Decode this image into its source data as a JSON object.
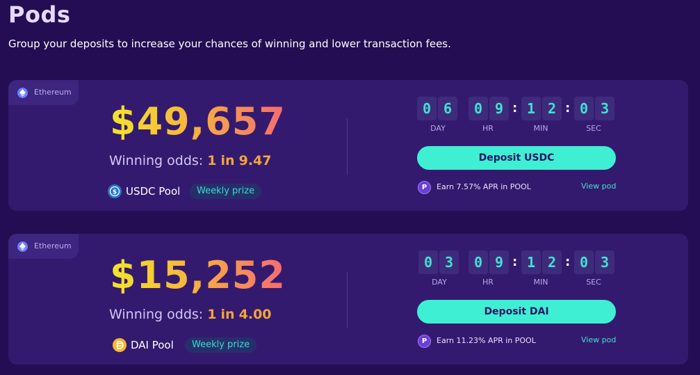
{
  "page": {
    "title": "Pods",
    "subtitle": "Group your deposits to increase your chances of winning and lower transaction fees."
  },
  "colors": {
    "background": "#240d52",
    "card": "#341a6e",
    "accent_teal": "#3fefd4",
    "odds_highlight": "#f1a53c",
    "prize_gradient": [
      "#f2e62b",
      "#f7b53c",
      "#f56a74"
    ]
  },
  "timer_labels": {
    "day": "DAY",
    "hr": "HR",
    "min": "MIN",
    "sec": "SEC"
  },
  "pods": [
    {
      "network": "Ethereum",
      "network_icon": "ethereum-icon",
      "prize": "$49,657",
      "odds_prefix": "Winning odds: ",
      "odds_one": "1",
      "odds_in": "in",
      "odds_value": "9.47",
      "token_icon": "usdc-icon",
      "pool_name": "USDC Pool",
      "prize_badge": "Weekly prize",
      "countdown": {
        "d1": "0",
        "d2": "6",
        "h1": "0",
        "h2": "9",
        "m1": "1",
        "m2": "2",
        "s1": "0",
        "s2": "3"
      },
      "deposit_label": "Deposit USDC",
      "apr_text": "Earn 7.57% APR in POOL",
      "view_label": "View pod"
    },
    {
      "network": "Ethereum",
      "network_icon": "ethereum-icon",
      "prize": "$15,252",
      "odds_prefix": "Winning odds: ",
      "odds_one": "1",
      "odds_in": "in",
      "odds_value": "4.00",
      "token_icon": "dai-icon",
      "pool_name": "DAI Pool",
      "prize_badge": "Weekly prize",
      "countdown": {
        "d1": "0",
        "d2": "3",
        "h1": "0",
        "h2": "9",
        "m1": "1",
        "m2": "2",
        "s1": "0",
        "s2": "3"
      },
      "deposit_label": "Deposit DAI",
      "apr_text": "Earn 11.23% APR in POOL",
      "view_label": "View pod"
    }
  ]
}
